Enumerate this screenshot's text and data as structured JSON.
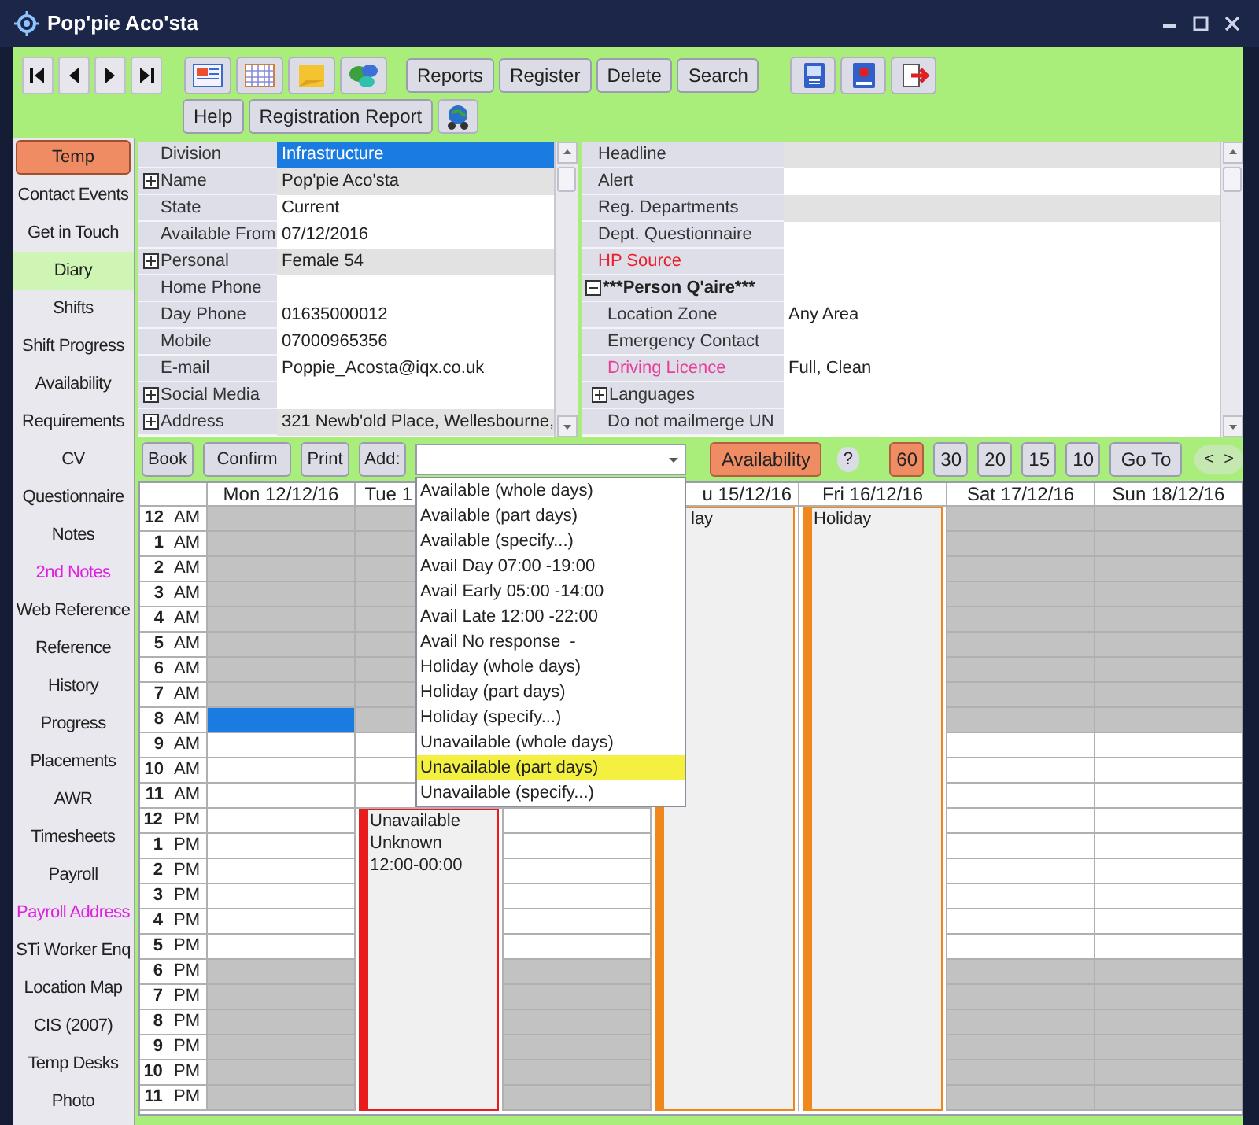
{
  "window": {
    "title": "Pop'pie Aco'sta"
  },
  "toolbar": {
    "row_1_buttons": [
      "Reports",
      "Register",
      "Delete",
      "Search"
    ],
    "row_2_buttons": [
      "Help",
      "Registration Report"
    ]
  },
  "record_type": {
    "label": "Temp"
  },
  "sidebar": {
    "items": [
      {
        "label": "Contact Events",
        "selected": false,
        "flagged": false
      },
      {
        "label": "Get in Touch",
        "selected": false,
        "flagged": false
      },
      {
        "label": "Diary",
        "selected": true,
        "flagged": false
      },
      {
        "label": "Shifts",
        "selected": false,
        "flagged": false
      },
      {
        "label": "Shift Progress",
        "selected": false,
        "flagged": false
      },
      {
        "label": "Availability",
        "selected": false,
        "flagged": false
      },
      {
        "label": "Requirements",
        "selected": false,
        "flagged": false
      },
      {
        "label": "CV",
        "selected": false,
        "flagged": false
      },
      {
        "label": "Questionnaire",
        "selected": false,
        "flagged": false
      },
      {
        "label": "Notes",
        "selected": false,
        "flagged": false
      },
      {
        "label": "2nd Notes",
        "selected": false,
        "flagged": true
      },
      {
        "label": "Web Reference",
        "selected": false,
        "flagged": false
      },
      {
        "label": "Reference",
        "selected": false,
        "flagged": false
      },
      {
        "label": "History",
        "selected": false,
        "flagged": false
      },
      {
        "label": "Progress",
        "selected": false,
        "flagged": false
      },
      {
        "label": "Placements",
        "selected": false,
        "flagged": false
      },
      {
        "label": "AWR",
        "selected": false,
        "flagged": false
      },
      {
        "label": "Timesheets",
        "selected": false,
        "flagged": false
      },
      {
        "label": "Payroll",
        "selected": false,
        "flagged": false
      },
      {
        "label": "Payroll Address",
        "selected": false,
        "flagged": true
      },
      {
        "label": "STi Worker Enq",
        "selected": false,
        "flagged": false
      },
      {
        "label": "Location Map",
        "selected": false,
        "flagged": false
      },
      {
        "label": "CIS (2007)",
        "selected": false,
        "flagged": false
      },
      {
        "label": "Temp Desks",
        "selected": false,
        "flagged": false
      },
      {
        "label": "Photo",
        "selected": false,
        "flagged": false
      }
    ]
  },
  "details_left": {
    "rows": [
      {
        "label": "Division",
        "value": "Infrastructure",
        "selected": true
      },
      {
        "label": "Name",
        "value": "Pop'pie Aco'sta",
        "selected": false,
        "shaded": true,
        "expanded": false
      },
      {
        "label": "State",
        "value": "Current",
        "selected": false,
        "shaded": false
      },
      {
        "label": "Available From",
        "value": "07/12/2016",
        "selected": false,
        "shaded": false
      },
      {
        "label": "Personal",
        "value": "Female 54",
        "selected": false,
        "shaded": true,
        "expanded": false
      },
      {
        "label": "Home Phone",
        "selected": false,
        "shaded": false
      },
      {
        "label": "Day Phone",
        "value": "01635000012",
        "selected": false,
        "shaded": false
      },
      {
        "label": "Mobile",
        "value": "07000965356",
        "selected": false,
        "shaded": false
      },
      {
        "label": "E-mail",
        "value": "Poppie_Acosta@iqx.co.uk",
        "selected": false,
        "shaded": false
      },
      {
        "label": "Social Media",
        "selected": false,
        "shaded": false,
        "expanded": false
      },
      {
        "label": "Address",
        "value": "321 Newb'old Place, Wellesbourne,",
        "selected": false,
        "shaded": true,
        "expanded": false
      }
    ]
  },
  "details_right": {
    "rows": [
      {
        "label": "Headline",
        "kind": "field",
        "shaded": true
      },
      {
        "label": "Alert",
        "kind": "field",
        "shaded": false
      },
      {
        "label": "Reg. Departments",
        "kind": "field",
        "shaded": true
      },
      {
        "label": "Dept. Questionnaire",
        "kind": "field",
        "shaded": false
      },
      {
        "label": "HP Source",
        "kind": "field",
        "shaded": false,
        "color": "#e8202a"
      },
      {
        "label": "***Person Q'aire***",
        "kind": "section",
        "shaded": false,
        "expanded": true,
        "children": [
          {
            "label": "Location Zone",
            "kind": "field",
            "value": "Any Area",
            "shaded": false
          },
          {
            "label": "Emergency Contact",
            "kind": "field",
            "shaded": false
          },
          {
            "label": "Driving Licence",
            "kind": "field",
            "value": "Full, Clean",
            "shaded": false,
            "color": "#e8409a"
          },
          {
            "label": "Languages",
            "kind": "field",
            "shaded": false,
            "expanded": false
          },
          {
            "label": "Do not mailmerge UN",
            "kind": "field",
            "shaded": false
          }
        ]
      }
    ]
  },
  "diary_toolbar": {
    "buttons": [
      "Book",
      "Confirm",
      "Print",
      "Add:"
    ],
    "add_select": {
      "open": true,
      "options": [
        {
          "label": "Available (whole days)",
          "selected": false
        },
        {
          "label": "Available (part days)",
          "selected": false
        },
        {
          "label": "Available (specify...)",
          "selected": false
        },
        {
          "label": "Avail Day 07:00 -19:00",
          "selected": false
        },
        {
          "label": "Avail Early 05:00 -14:00",
          "selected": false
        },
        {
          "label": "Avail Late 12:00 -22:00",
          "selected": false
        },
        {
          "label": "Avail No response  -",
          "selected": false
        },
        {
          "label": "Holiday (whole days)",
          "selected": false
        },
        {
          "label": "Holiday (part days)",
          "selected": false
        },
        {
          "label": "Holiday (specify...)",
          "selected": false
        },
        {
          "label": "Unavailable (whole days)",
          "selected": false
        },
        {
          "label": "Unavailable (part days)",
          "selected": true
        },
        {
          "label": "Unavailable (specify...)",
          "selected": false
        }
      ]
    },
    "availability": {
      "label": "Availability",
      "active": true
    },
    "help": "?",
    "intervals": [
      {
        "label": "60",
        "selected": true
      },
      {
        "label": "30",
        "selected": false
      },
      {
        "label": "20",
        "selected": false
      },
      {
        "label": "15",
        "selected": false
      },
      {
        "label": "10",
        "selected": false
      }
    ],
    "go_to": "Go To",
    "prev": "<",
    "next": ">"
  },
  "calendar": {
    "days": [
      {
        "header": "Mon 12/12/16",
        "kind": "day"
      },
      {
        "header": "Tue 1",
        "kind": "day",
        "events": [
          {
            "kind": "from_noon",
            "color": "#e81c1c",
            "lines": [
              "Unavailable",
              "Unknown",
              "12:00-00:00"
            ]
          }
        ]
      },
      {
        "kind": "day"
      },
      {
        "header": "u 15/12/16",
        "kind": "day",
        "events": [
          {
            "kind": "whole_day",
            "color": "#f0871c",
            "lines": [
              "lay"
            ]
          }
        ]
      },
      {
        "header": "Fri 16/12/16",
        "kind": "day",
        "events": [
          {
            "kind": "whole_day",
            "color": "#f0871c",
            "lines": [
              "Holiday"
            ]
          }
        ]
      },
      {
        "header": "Sat 17/12/16",
        "kind": "day"
      },
      {
        "header": "Sun 18/12/16",
        "kind": "day"
      }
    ],
    "rows": [
      {
        "label": "**12** AM",
        "shaded": true,
        "selected": false
      },
      {
        "label": "**1** AM",
        "shaded": true,
        "selected": false
      },
      {
        "label": "**2** AM",
        "shaded": true,
        "selected": false
      },
      {
        "label": "**3** AM",
        "shaded": true,
        "selected": false
      },
      {
        "label": "**4** AM",
        "shaded": true,
        "selected": false
      },
      {
        "label": "**5** AM",
        "shaded": true,
        "selected": false
      },
      {
        "label": "**6** AM",
        "shaded": true,
        "selected": false
      },
      {
        "label": "**7** AM",
        "shaded": true,
        "selected": false
      },
      {
        "label": "**8** AM",
        "shaded": true,
        "selected": true
      },
      {
        "label": "**9** AM",
        "shaded": false,
        "selected": false
      },
      {
        "label": "**10** AM",
        "shaded": false,
        "selected": false
      },
      {
        "label": "**11** AM",
        "shaded": false,
        "selected": false
      },
      {
        "label": "**12** PM",
        "shaded": false,
        "selected": false
      },
      {
        "label": "**1** PM",
        "shaded": false,
        "selected": false
      },
      {
        "label": "**2** PM",
        "shaded": false,
        "selected": false
      },
      {
        "label": "**3** PM",
        "shaded": false,
        "selected": false
      },
      {
        "label": "**4** PM",
        "shaded": false,
        "selected": false
      },
      {
        "label": "**5** PM",
        "shaded": false,
        "selected": false
      },
      {
        "label": "**6** PM",
        "shaded": true,
        "selected": false
      },
      {
        "label": "**7** PM",
        "shaded": true,
        "selected": false
      },
      {
        "label": "**8** PM",
        "shaded": true,
        "selected": false
      },
      {
        "label": "**9** PM",
        "shaded": true,
        "selected": false
      },
      {
        "label": "**10** PM",
        "shaded": true,
        "selected": false
      },
      {
        "label": "**11** PM",
        "shaded": true,
        "selected": false
      }
    ]
  }
}
